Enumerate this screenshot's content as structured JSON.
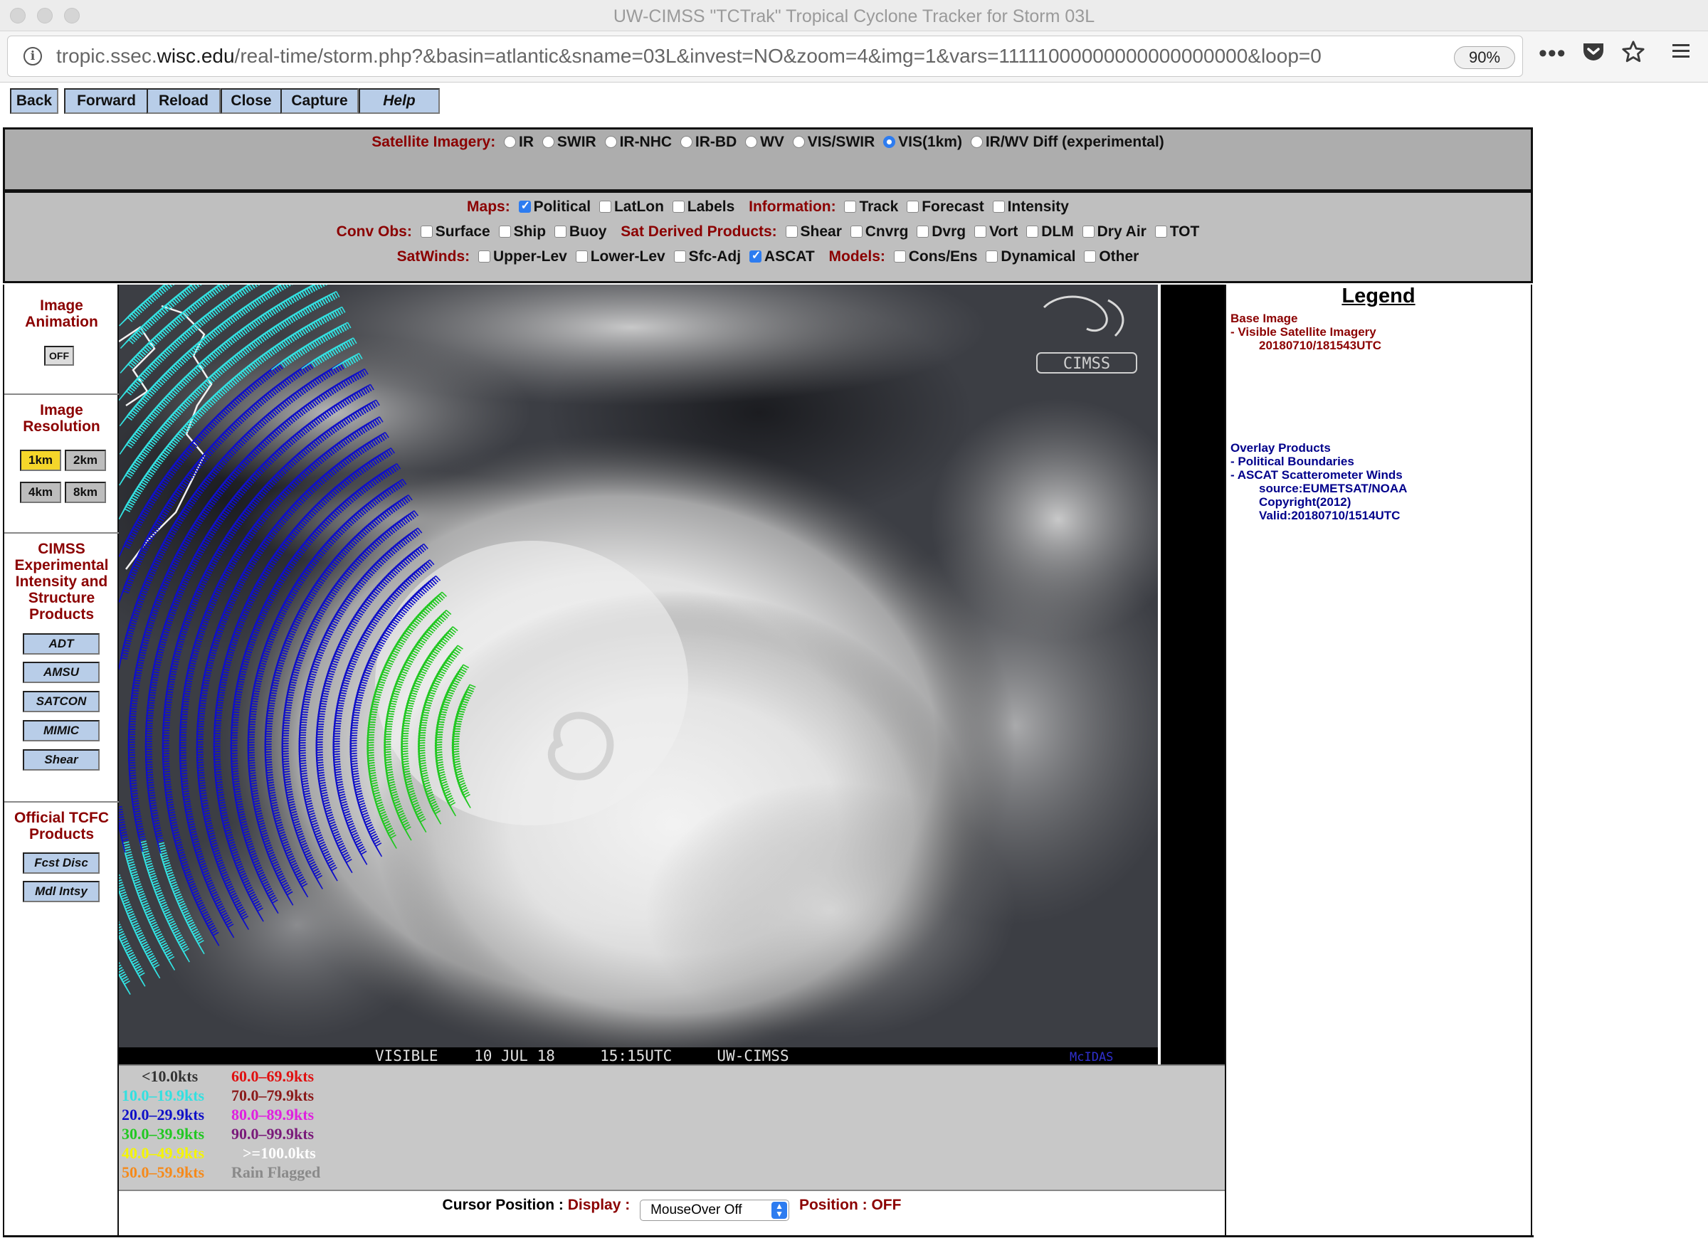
{
  "window": {
    "title": "UW-CIMSS \"TCTrak\" Tropical Cyclone Tracker for Storm 03L"
  },
  "browser": {
    "url_pre": "tropic.ssec.",
    "url_host": "wisc.edu",
    "url_post": "/real-time/storm.php?&basin=atlantic&sname=03L&invest=NO&zoom=4&img=1&vars=11111000000000000000000&loop=0",
    "zoom": "90%",
    "icons": {
      "info": "info-icon",
      "more": "ellipsis-icon",
      "pocket": "pocket-icon",
      "bookmark": "star-icon",
      "menu": "hamburger-icon"
    }
  },
  "nav_buttons": [
    "Back",
    "Forward",
    "Reload",
    "Close",
    "Capture",
    "Help"
  ],
  "satellite_imagery": {
    "label": "Satellite Imagery:",
    "options": [
      {
        "label": "IR",
        "selected": false
      },
      {
        "label": "SWIR",
        "selected": false
      },
      {
        "label": "IR-NHC",
        "selected": false
      },
      {
        "label": "IR-BD",
        "selected": false
      },
      {
        "label": "WV",
        "selected": false
      },
      {
        "label": "VIS/SWIR",
        "selected": false
      },
      {
        "label": "VIS(1km)",
        "selected": true
      },
      {
        "label": "IR/WV Diff (experimental)",
        "selected": false
      }
    ]
  },
  "maps": {
    "label": "Maps:",
    "options": [
      {
        "label": "Political",
        "checked": true
      },
      {
        "label": "LatLon",
        "checked": false
      },
      {
        "label": "Labels",
        "checked": false
      }
    ],
    "info_label": "Information:",
    "info_options": [
      {
        "label": "Track",
        "checked": false
      },
      {
        "label": "Forecast",
        "checked": false
      },
      {
        "label": "Intensity",
        "checked": false
      }
    ]
  },
  "conv_obs": {
    "label": "Conv Obs:",
    "options": [
      {
        "label": "Surface",
        "checked": false
      },
      {
        "label": "Ship",
        "checked": false
      },
      {
        "label": "Buoy",
        "checked": false
      }
    ],
    "sat_label": "Sat Derived Products:",
    "sat_options": [
      {
        "label": "Shear",
        "checked": false
      },
      {
        "label": "Cnvrg",
        "checked": false
      },
      {
        "label": "Dvrg",
        "checked": false
      },
      {
        "label": "Vort",
        "checked": false
      },
      {
        "label": "DLM",
        "checked": false
      },
      {
        "label": "Dry Air",
        "checked": false
      },
      {
        "label": "TOT",
        "checked": false
      }
    ]
  },
  "satwinds": {
    "label": "SatWinds:",
    "options": [
      {
        "label": "Upper-Lev",
        "checked": false
      },
      {
        "label": "Lower-Lev",
        "checked": false
      },
      {
        "label": "Sfc-Adj",
        "checked": false
      },
      {
        "label": "ASCAT",
        "checked": true
      }
    ],
    "models_label": "Models:",
    "models_options": [
      {
        "label": "Cons/Ens",
        "checked": false
      },
      {
        "label": "Dynamical",
        "checked": false
      },
      {
        "label": "Other",
        "checked": false
      }
    ]
  },
  "sidebar": {
    "animation": {
      "title": "Image Animation",
      "button": "OFF"
    },
    "resolution": {
      "title": "Image Resolution",
      "buttons": [
        "1km",
        "2km",
        "4km",
        "8km"
      ],
      "selected": "1km"
    },
    "cimss": {
      "title": "CIMSS Experimental Intensity and Structure Products",
      "buttons": [
        "ADT",
        "AMSU",
        "SATCON",
        "MIMIC",
        "Shear"
      ]
    },
    "official": {
      "title": "Official TCFC Products",
      "buttons": [
        "Fcst Disc",
        "Mdl Intsy"
      ]
    }
  },
  "image": {
    "caption": "VISIBLE    10 JUL 18     15:15UTC     UW-CIMSS",
    "brand": "McIDAS",
    "logo": "CIMSS"
  },
  "legend": {
    "title": "Legend",
    "base_heading": "Base Image",
    "base_item": "-  Visible Satellite Imagery",
    "base_time": "20180710/181543UTC",
    "overlay_heading": "Overlay Products",
    "overlay_items": [
      "-  Political Boundaries",
      "-  ASCAT Scatterometer Winds"
    ],
    "overlay_source": "source:EUMETSAT/NOAA",
    "overlay_copyright": "Copyright(2012)",
    "overlay_valid": "Valid:20180710/1514UTC"
  },
  "wind_legend": [
    {
      "label": "<10.0kts",
      "color": "#333333"
    },
    {
      "label": "10.0–19.9kts",
      "color": "#33e0e0"
    },
    {
      "label": "20.0–29.9kts",
      "color": "#1010c8"
    },
    {
      "label": "30.0–39.9kts",
      "color": "#22c822"
    },
    {
      "label": "40.0–49.9kts",
      "color": "#f5f500"
    },
    {
      "label": "50.0–59.9kts",
      "color": "#f58a1a"
    },
    {
      "label": "60.0–69.9kts",
      "color": "#e01010"
    },
    {
      "label": "70.0–79.9kts",
      "color": "#8b1a1a"
    },
    {
      "label": "80.0–89.9kts",
      "color": "#e020e0"
    },
    {
      "label": "90.0–99.9kts",
      "color": "#7a1a7a"
    },
    {
      "label": ">=100.0kts",
      "color": "#ffffff"
    },
    {
      "label": "Rain Flagged",
      "color": "#8a8a8a"
    }
  ],
  "cursor": {
    "label": "Cursor Position :",
    "display_label": "Display :",
    "display_value": "MouseOver Off",
    "position_label": "Position :",
    "position_value": "OFF"
  }
}
